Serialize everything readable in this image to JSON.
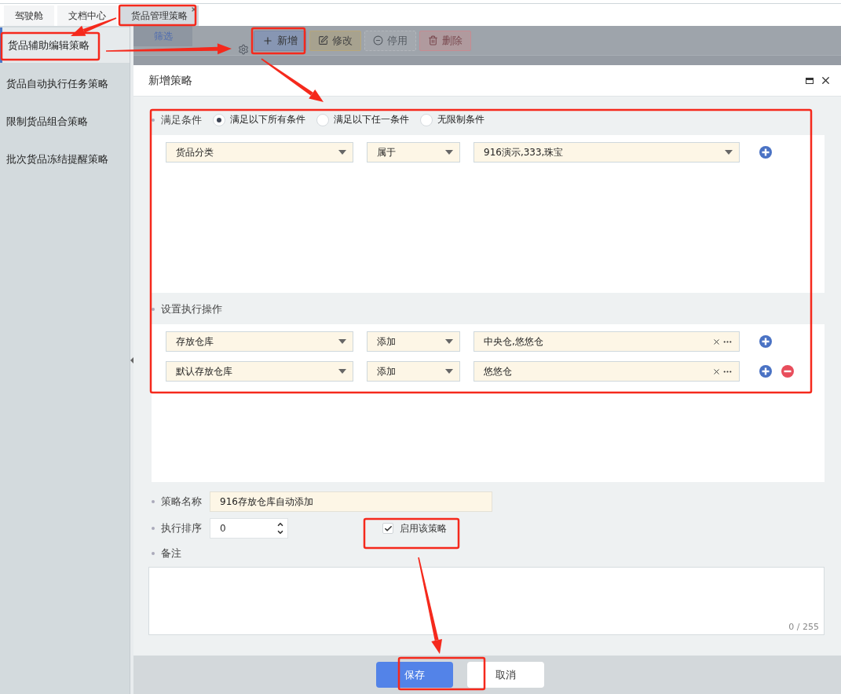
{
  "tabs": [
    {
      "label": "驾驶舱",
      "selected": false,
      "closable": false
    },
    {
      "label": "文档中心",
      "selected": false,
      "closable": false
    },
    {
      "label": "货品管理策略",
      "selected": true,
      "closable": true
    }
  ],
  "sidebar": {
    "items": [
      {
        "label": "货品辅助编辑策略",
        "selected": true
      },
      {
        "label": "货品自动执行任务策略",
        "selected": false
      },
      {
        "label": "限制货品组合策略",
        "selected": false
      },
      {
        "label": "批次货品冻结提醒策略",
        "selected": false
      }
    ]
  },
  "filter_tab": {
    "label": "筛选"
  },
  "toolbar": {
    "buttons": [
      {
        "label": "新增",
        "kind": "add",
        "disabled": false
      },
      {
        "label": "修改",
        "kind": "edit",
        "disabled": false
      },
      {
        "label": "停用",
        "kind": "disable",
        "disabled": true
      },
      {
        "label": "删除",
        "kind": "delete",
        "disabled": false
      }
    ]
  },
  "dialog": {
    "title": "新增策略",
    "conditions": {
      "label": "满足条件",
      "options": [
        {
          "label": "满足以下所有条件",
          "selected": true
        },
        {
          "label": "满足以下任一条件",
          "selected": false
        },
        {
          "label": "无限制条件",
          "selected": false
        }
      ],
      "rows": [
        {
          "field": "货品分类",
          "operator": "属于",
          "value": "916演示,333,珠宝",
          "removable": false
        }
      ]
    },
    "actions": {
      "label": "设置执行操作",
      "rows": [
        {
          "field": "存放仓库",
          "operator": "添加",
          "value": "中央仓,悠悠仓",
          "removable": false
        },
        {
          "field": "默认存放仓库",
          "operator": "添加",
          "value": "悠悠仓",
          "removable": true
        }
      ]
    },
    "name": {
      "label": "策略名称",
      "value": "916存放仓库自动添加"
    },
    "order": {
      "label": "执行排序",
      "value": "0"
    },
    "enabled": {
      "label": "启用该策略",
      "checked": true
    },
    "remark": {
      "label": "备注",
      "counter": "0 / 255"
    },
    "buttons": [
      {
        "label": "保存",
        "kind": "primary"
      },
      {
        "label": "取消",
        "kind": "secondary"
      }
    ]
  }
}
